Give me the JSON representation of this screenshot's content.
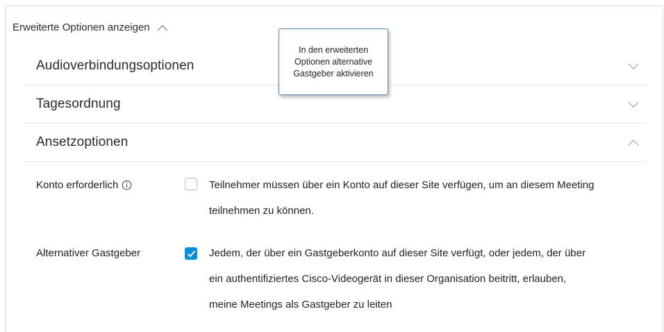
{
  "advanced": {
    "toggle_label": "Erweiterte Optionen anzeigen",
    "toggle_icon": "chevron-up-icon"
  },
  "sections": [
    {
      "title": "Audioverbindungsoptionen",
      "state": "collapsed",
      "icon": "chevron-down-icon"
    },
    {
      "title": "Tagesordnung",
      "state": "collapsed",
      "icon": "chevron-down-icon"
    },
    {
      "title": "Ansetzoptionen",
      "state": "expanded",
      "icon": "chevron-up-icon"
    }
  ],
  "options": {
    "account_required": {
      "label": "Konto erforderlich",
      "info_icon": "info-icon",
      "checked": false,
      "lines": [
        "Teilnehmer müssen über ein Konto auf dieser Site verfügen, um an diesem Meeting",
        "teilnehmen zu können."
      ]
    },
    "alternate_host": {
      "label": "Alternativer Gastgeber",
      "checked": true,
      "lines": [
        "Jedem, der über ein Gastgeberkonto auf dieser Site verfügt, oder jedem, der über",
        "ein authentifiziertes Cisco-Videogerät in dieser Organisation beitritt, erlauben,",
        "meine Meetings als Gastgeber zu leiten"
      ]
    }
  },
  "tooltip": {
    "lines": [
      "In den erweiterten",
      "Optionen alternative",
      "Gastgeber aktivieren"
    ]
  },
  "colors": {
    "checkbox_checked": "#0a8fd6",
    "border": "#d6d6d6",
    "tooltip_border": "#5b7fa6"
  }
}
